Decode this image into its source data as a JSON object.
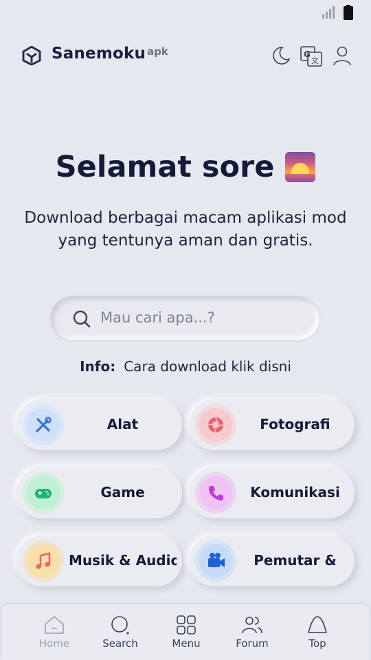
{
  "status_bar": {
    "signal_icon": "signal-icon",
    "battery_icon": "battery-icon"
  },
  "header": {
    "brand": "Sanemoku",
    "brand_sup": "apk",
    "icons": [
      "logo-icon",
      "moon-icon",
      "translate-icon",
      "user-icon"
    ]
  },
  "hero": {
    "greeting": "Selamat sore",
    "greeting_emoji": "sunset-icon",
    "subtitle": "Download berbagai macam aplikasi mod yang tentunya aman dan gratis."
  },
  "search": {
    "placeholder": "Mau cari apa...?"
  },
  "info": {
    "label": "Info:",
    "text": "Cara download klik disni"
  },
  "categories": [
    {
      "label": "Alat",
      "icon": "tools-icon",
      "color": "#cfe0fb"
    },
    {
      "label": "Fotografi",
      "icon": "camera-aperture-icon",
      "color": "#f5d0d4"
    },
    {
      "label": "Game",
      "icon": "gamepad-icon",
      "color": "#c9f1dc"
    },
    {
      "label": "Komunikasi",
      "icon": "phone-icon",
      "color": "#f0c9f4"
    },
    {
      "label": "Musik & Audio",
      "icon": "music-note-icon",
      "color": "#f8e2b8"
    },
    {
      "label": "Pemutar &",
      "icon": "video-camera-icon",
      "color": "#cfe0fb"
    }
  ],
  "bottom_nav": [
    {
      "label": "Home",
      "icon": "home-icon",
      "active": true
    },
    {
      "label": "Search",
      "icon": "search-icon",
      "active": false
    },
    {
      "label": "Menu",
      "icon": "grid-icon",
      "active": false
    },
    {
      "label": "Forum",
      "icon": "users-icon",
      "active": false
    },
    {
      "label": "Top",
      "icon": "chevron-up-icon",
      "active": false
    }
  ]
}
